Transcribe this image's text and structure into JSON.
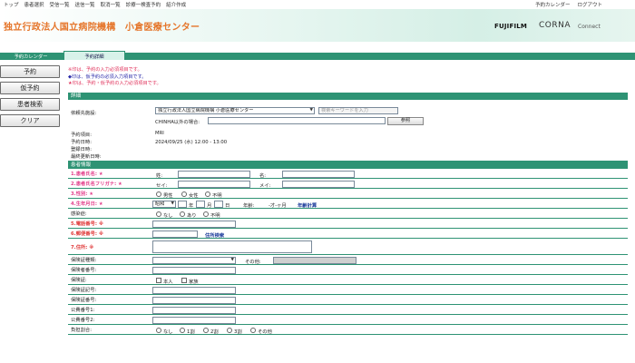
{
  "topnav": {
    "left": [
      "トップ",
      "患者選択",
      "受信一覧",
      "送信一覧",
      "取消一覧",
      "診療一検査予約",
      "紹介作成"
    ],
    "right": [
      "予約カレンダー",
      "ログアウト"
    ]
  },
  "header": {
    "title": "独立行政法人国立病院機構　小倉医療センター",
    "fujifilm": "FUJIFILM",
    "corna": "CORNA",
    "connect": "Connect"
  },
  "tabs": [
    "予約カレンダー",
    "予約詳細"
  ],
  "sidebar": [
    "予約",
    "仮予約",
    "患者検索",
    "クリア"
  ],
  "notes": [
    {
      "text": "※印は、予約の入力必須項目です。",
      "color": "red"
    },
    {
      "text": "◆印は、仮予約の必須入力項目です。",
      "color": "blue"
    },
    {
      "text": "★印は、予約・仮予約の入力必須項目です。",
      "color": "red"
    }
  ],
  "details": {
    "header": "詳細",
    "dest_label": "依頼先施設:",
    "dest_value": "独立行政法人国立病院機構 小倉医療センター",
    "search_placeholder": "検索キーワードを入力",
    "other_label": "CHINHA以外の場合:",
    "ref_button": "参照",
    "rows": [
      {
        "label": "予約項目:",
        "value": "MRI"
      },
      {
        "label": "予約日時:",
        "value": "2024/09/25 (水) 12:00 - 13:00"
      },
      {
        "label": "登録日時:",
        "value": ""
      },
      {
        "label": "最終更新日時:",
        "value": ""
      }
    ]
  },
  "patient": {
    "header": "患者情報",
    "name_label": "1.患者氏名: ★",
    "sei": "姓:",
    "mei": "名:",
    "kana_label": "2.患者氏名フリガナ: ★",
    "kana_sei": "セイ:",
    "kana_mei": "メイ:",
    "sex_label": "3.性別: ★",
    "sex_options": [
      "男性",
      "女性",
      "不明"
    ],
    "dob_label": "4.生年月日: ★",
    "era": "昭和",
    "year": "年",
    "month": "月",
    "day": "日",
    "age_label": "年齢:",
    "age_value": "-才-ヶ月",
    "age_calc": "年齢計算",
    "infection_label": "感染症:",
    "infection_options": [
      "なし",
      "あり",
      "不明"
    ],
    "phone_label": "5.電話番号: ※",
    "postal_label": "6.郵便番号: ※",
    "address_search": "住所検索",
    "address_label": "7.住所: ※",
    "ins_type_label": "保険証種類:",
    "ins_other": "その他:",
    "insurer_label": "保険者番号:",
    "ins_card_label": "保険証:",
    "ins_card_options": [
      "本人",
      "家族"
    ],
    "ins_symbol_label": "保険証記号:",
    "ins_number_label": "保険証番号:",
    "pub1_label": "公費番号1:",
    "pub2_label": "公費番号2:",
    "copay_label": "負担割合:",
    "copay_options": [
      "なし",
      "1割",
      "2割",
      "3割",
      "その他"
    ]
  }
}
